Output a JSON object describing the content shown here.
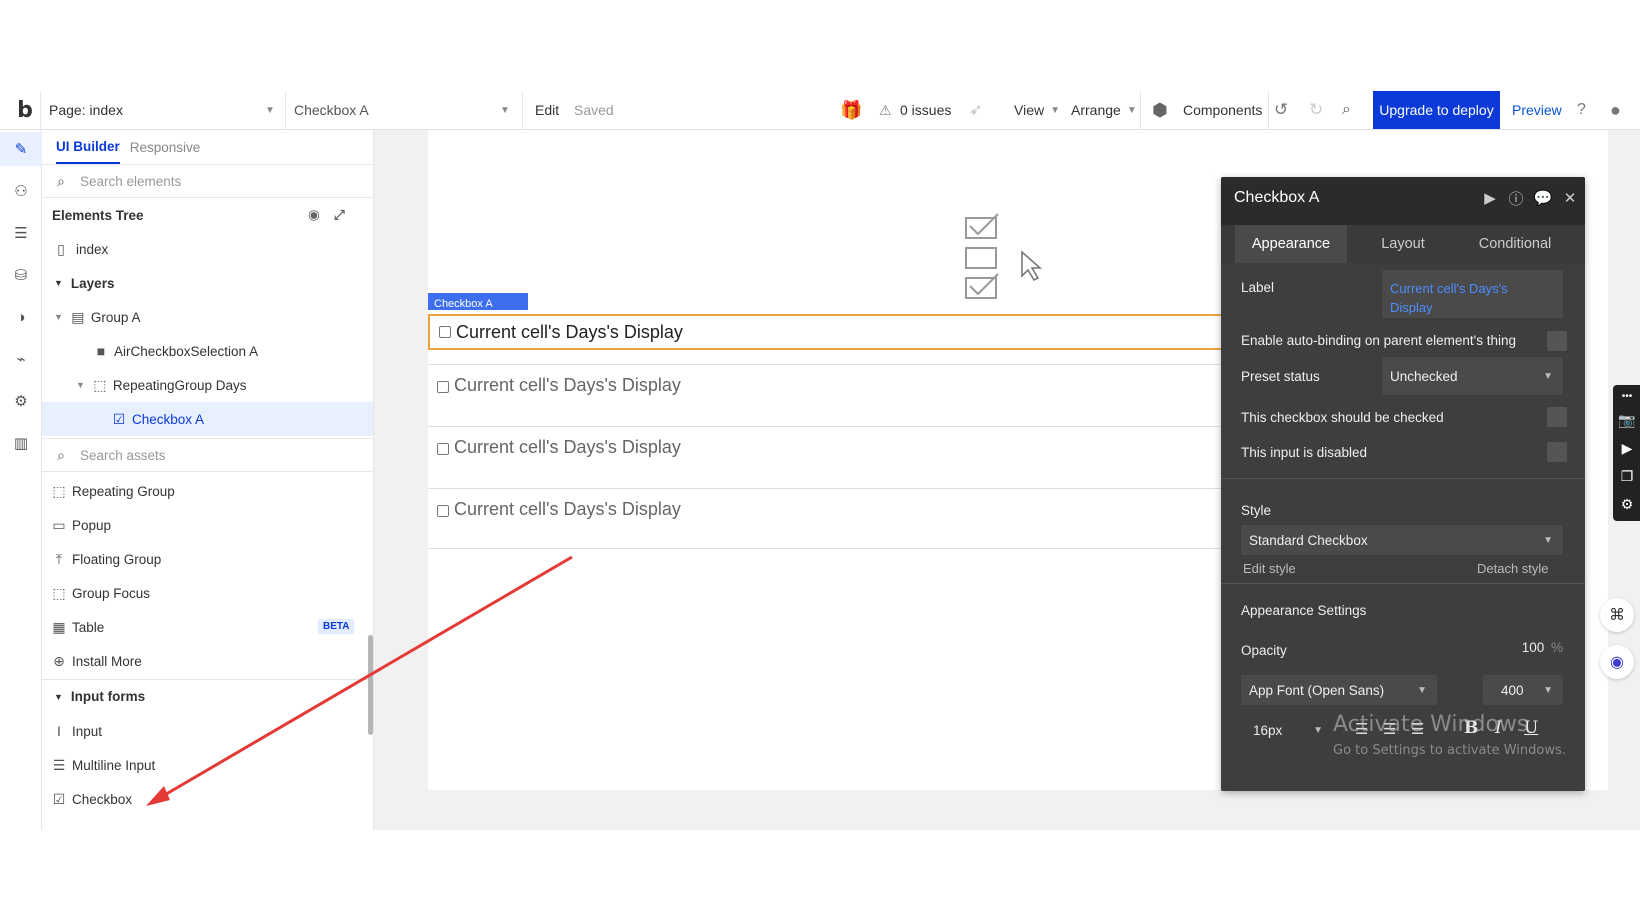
{
  "topbar": {
    "logo": "b",
    "page_label": "Page: index",
    "element_label": "Checkbox A",
    "edit_label": "Edit",
    "saved_label": "Saved",
    "issues_label": "0 issues",
    "view_label": "View",
    "arrange_label": "Arrange",
    "components_label": "Components",
    "upgrade_label": "Upgrade to deploy",
    "preview_label": "Preview"
  },
  "panel": {
    "tab_ui_builder": "UI Builder",
    "tab_responsive": "Responsive",
    "search_elements_placeholder": "Search elements",
    "elements_tree_title": "Elements Tree",
    "tree": [
      {
        "label": "index"
      },
      {
        "label": "Layers"
      },
      {
        "label": "Group A"
      },
      {
        "label": "AirCheckboxSelection A"
      },
      {
        "label": "RepeatingGroup Days"
      },
      {
        "label": "Checkbox A"
      }
    ],
    "search_assets_placeholder": "Search assets",
    "assets": [
      {
        "label": "Repeating Group"
      },
      {
        "label": "Popup"
      },
      {
        "label": "Floating Group"
      },
      {
        "label": "Group Focus"
      },
      {
        "label": "Table",
        "badge": "BETA"
      },
      {
        "label": "Install More"
      }
    ],
    "input_forms_title": "Input forms",
    "input_forms": [
      {
        "label": "Input"
      },
      {
        "label": "Multiline Input"
      },
      {
        "label": "Checkbox"
      }
    ]
  },
  "canvas": {
    "rg_label": "Checkbox A",
    "cells": [
      "Current cell's Days's Display",
      "Current cell's Days's Display",
      "Current cell's Days's Display",
      "Current cell's Days's Display"
    ]
  },
  "property_editor": {
    "title": "Checkbox A",
    "tabs": [
      "Appearance",
      "Layout",
      "Conditional"
    ],
    "label_label": "Label",
    "label_value_line1": "Current cell's Days's",
    "label_value_line2": "Display",
    "auto_binding_label": "Enable auto-binding on parent element's thing",
    "preset_status_label": "Preset status",
    "preset_status_value": "Unchecked",
    "should_be_checked_label": "This checkbox should be checked",
    "disabled_label": "This input is disabled",
    "style_title": "Style",
    "style_value": "Standard Checkbox",
    "edit_style_label": "Edit style",
    "detach_style_label": "Detach style",
    "appearance_settings_title": "Appearance Settings",
    "opacity_label": "Opacity",
    "opacity_value": "100",
    "opacity_unit": "%",
    "font_value": "App Font (Open Sans)",
    "font_weight_value": "400",
    "font_size_value": "16px",
    "bold_label": "B",
    "italic_label": "I",
    "underline_label": "U",
    "watermark_line1": "Activate Windows",
    "watermark_line2": "Go to Settings to activate Windows."
  },
  "colors": {
    "accent": "#0b3ad9",
    "selection": "#e8efff",
    "focus_border": "#e8a33c",
    "arrow": "#e53935",
    "editor_bg": "#3e3e3e"
  }
}
